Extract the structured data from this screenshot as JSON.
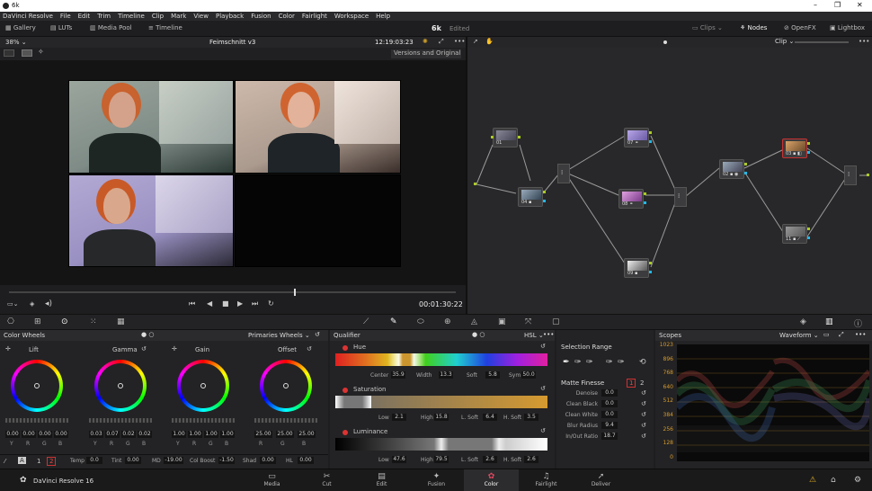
{
  "window": {
    "title": "6k",
    "controls": [
      "–",
      "❐",
      "✕"
    ]
  },
  "menu": [
    "DaVinci Resolve",
    "File",
    "Edit",
    "Trim",
    "Timeline",
    "Clip",
    "Mark",
    "View",
    "Playback",
    "Fusion",
    "Color",
    "Fairlight",
    "Workspace",
    "Help"
  ],
  "toolbar": {
    "gallery": "Gallery",
    "luts": "LUTs",
    "media_pool": "Media Pool",
    "timeline": "Timeline",
    "project": "6k",
    "edited": "Edited",
    "clips": "Clips",
    "nodes": "Nodes",
    "openfx": "OpenFX",
    "lightbox": "Lightbox"
  },
  "viewer": {
    "zoom": "38%",
    "clip_name": "Feimschnitt v3",
    "timecode": "12:19:03:23",
    "versions": "Versions and Original",
    "duration": "00:01:30:22"
  },
  "nodes": {
    "mode": "Clip",
    "items": [
      {
        "id": "01"
      },
      {
        "id": "04"
      },
      {
        "id": "07"
      },
      {
        "id": "08"
      },
      {
        "id": "09"
      },
      {
        "id": "02"
      },
      {
        "id": "03"
      },
      {
        "id": "11"
      }
    ]
  },
  "color_wheels": {
    "title": "Color Wheels",
    "mode": "Primaries Wheels",
    "wheels": [
      {
        "name": "Lift",
        "values": [
          "0.00",
          "0.00",
          "0.00",
          "0.00"
        ]
      },
      {
        "name": "Gamma",
        "values": [
          "0.03",
          "0.07",
          "0.02",
          "0.02"
        ]
      },
      {
        "name": "Gain",
        "values": [
          "1.00",
          "1.00",
          "1.00",
          "1.00"
        ]
      },
      {
        "name": "Offset",
        "values": [
          "25.00",
          "25.00",
          "25.00"
        ]
      }
    ],
    "channel_labels": [
      "Y",
      "R",
      "G",
      "B"
    ],
    "offset_labels": [
      "R",
      "G",
      "B"
    ],
    "page_buttons": [
      "1",
      "2"
    ],
    "adjust": [
      {
        "label": "Temp",
        "value": "0.0"
      },
      {
        "label": "Tint",
        "value": "0.00"
      },
      {
        "label": "MD",
        "value": "-19.00"
      },
      {
        "label": "Col Boost",
        "value": "-1.50"
      },
      {
        "label": "Shad",
        "value": "0.00"
      },
      {
        "label": "HL",
        "value": "0.00"
      }
    ]
  },
  "qualifier": {
    "title": "Qualifier",
    "mode": "HSL",
    "hue": {
      "label": "Hue",
      "fields": [
        {
          "k": "Center",
          "v": "35.9"
        },
        {
          "k": "Width",
          "v": "13.3"
        },
        {
          "k": "Soft",
          "v": "5.8"
        },
        {
          "k": "Sym",
          "v": "50.0"
        }
      ]
    },
    "saturation": {
      "label": "Saturation",
      "fields": [
        {
          "k": "Low",
          "v": "2.1"
        },
        {
          "k": "High",
          "v": "15.8"
        },
        {
          "k": "L. Soft",
          "v": "6.4"
        },
        {
          "k": "H. Soft",
          "v": "3.5"
        }
      ]
    },
    "luminance": {
      "label": "Luminance",
      "fields": [
        {
          "k": "Low",
          "v": "47.6"
        },
        {
          "k": "High",
          "v": "79.5"
        },
        {
          "k": "L. Soft",
          "v": "2.6"
        },
        {
          "k": "H. Soft",
          "v": "2.6"
        }
      ]
    }
  },
  "selection_range": {
    "title": "Selection Range",
    "matte_title": "Matte Finesse",
    "pages": [
      "1",
      "2"
    ],
    "rows": [
      {
        "k": "Denoise",
        "v": "0.0"
      },
      {
        "k": "Clean Black",
        "v": "0.0"
      },
      {
        "k": "Clean White",
        "v": "0.0"
      },
      {
        "k": "Blur Radius",
        "v": "9.4"
      },
      {
        "k": "In/Out Ratio",
        "v": "18.7"
      }
    ]
  },
  "scopes": {
    "title": "Scopes",
    "mode": "Waveform",
    "ticks": [
      "1023",
      "896",
      "768",
      "640",
      "512",
      "384",
      "256",
      "128",
      "0"
    ]
  },
  "bottom": {
    "app": "DaVinci Resolve 16",
    "pages": [
      "Media",
      "Cut",
      "Edit",
      "Fusion",
      "Color",
      "Fairlight",
      "Deliver"
    ],
    "active": "Color"
  },
  "colors": {
    "accent": "#d0a02a",
    "active_page": "#e04860",
    "record": "#d33333"
  }
}
